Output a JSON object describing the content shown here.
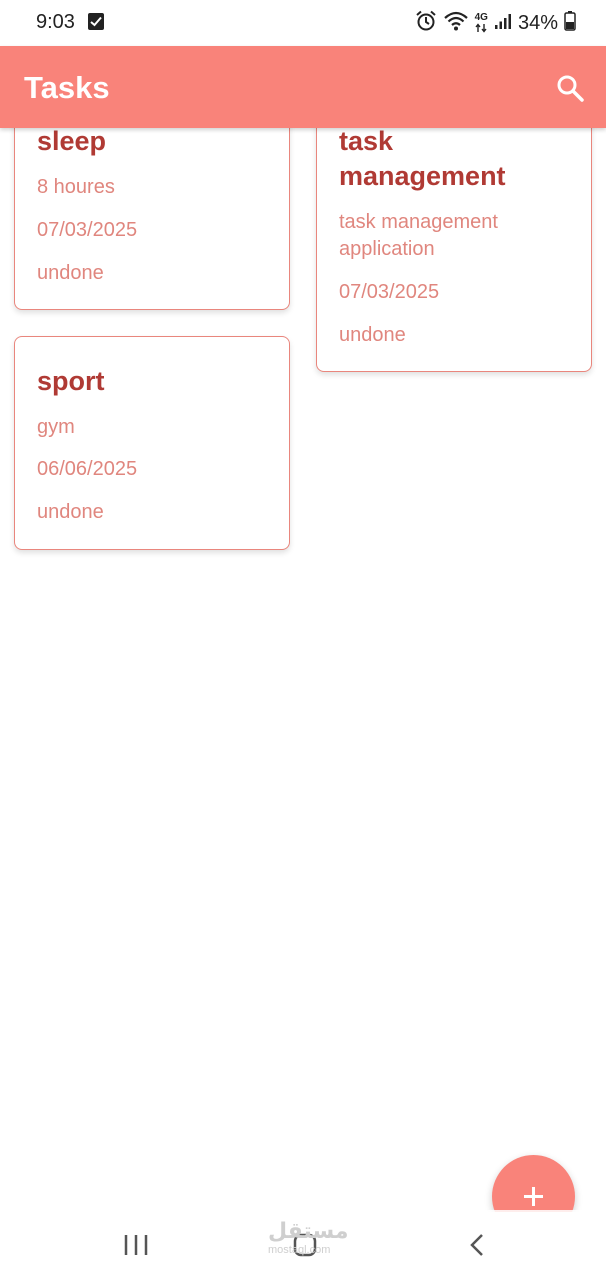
{
  "status_bar": {
    "time": "9:03",
    "network": "4G",
    "battery": "34%",
    "icons": [
      "checkbox-notification-icon",
      "alarm-icon",
      "wifi-icon",
      "network-4g-icon",
      "signal-icon",
      "battery-icon"
    ]
  },
  "app_bar": {
    "title": "Tasks",
    "search_icon": "search-icon"
  },
  "tasks": [
    {
      "title": "sleep",
      "description": "8 houres",
      "date": "07/03/2025",
      "status": "undone"
    },
    {
      "title_line1": "task",
      "title_line2": "management",
      "description_line1": "task management",
      "description_line2": "application",
      "date": "07/03/2025",
      "status": "undone"
    },
    {
      "title": "sport",
      "description": "gym",
      "date": "06/06/2025",
      "status": "undone"
    }
  ],
  "fab": {
    "icon": "plus-icon",
    "label": "+"
  },
  "nav_bar": {
    "icons": [
      "recent-apps-icon",
      "home-icon",
      "back-icon"
    ]
  },
  "watermark": {
    "text": "مستقل",
    "sub": "mostaql.com"
  },
  "colors": {
    "accent": "#f9837a",
    "title_text": "#b03a34",
    "body_text": "#e0867e",
    "card_border": "#e9867d"
  }
}
